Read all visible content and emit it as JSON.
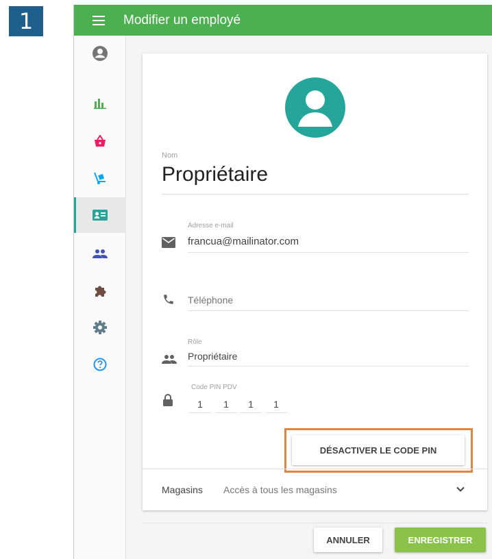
{
  "step_badge": "1",
  "topbar": {
    "title": "Modifier un employé",
    "menu_icon": "hamburger-menu-icon"
  },
  "sidebar": {
    "items": [
      {
        "name": "profile",
        "icon": "account-circle-icon",
        "color": "#757575"
      },
      {
        "name": "reports",
        "icon": "bar-chart-icon",
        "color": "#4caf50"
      },
      {
        "name": "items",
        "icon": "basket-icon",
        "color": "#e91e63"
      },
      {
        "name": "inventory",
        "icon": "cart-dolly-icon",
        "color": "#03a9f4"
      },
      {
        "name": "employees",
        "icon": "id-badge-icon",
        "color": "#26a69a",
        "active": true
      },
      {
        "name": "customers",
        "icon": "people-icon",
        "color": "#3f51b5"
      },
      {
        "name": "integrations",
        "icon": "puzzle-icon",
        "color": "#6d4c41"
      },
      {
        "name": "settings",
        "icon": "gear-icon",
        "color": "#607d8b"
      },
      {
        "name": "help",
        "icon": "help-circle-icon",
        "color": "#2196f3"
      }
    ]
  },
  "form": {
    "name_label": "Nom",
    "name_value": "Propriétaire",
    "email_label": "Adresse e-mail",
    "email_value": "francua@mailinator.com",
    "phone_placeholder": "Téléphone",
    "role_label": "Rôle",
    "role_value": "Propriétaire",
    "pin_label": "Code PIN PDV",
    "pin_digits": [
      "1",
      "1",
      "1",
      "1"
    ],
    "deactivate_pin_label": "DÉSACTIVER LE CODE PIN",
    "stores_label": "Magasins",
    "stores_value": "Accès à tous les magasins"
  },
  "actions": {
    "cancel_label": "ANNULER",
    "save_label": "ENREGISTRER"
  },
  "colors": {
    "topbar": "#4caf50",
    "accent": "#26a69a",
    "save": "#8bc34a",
    "highlight": "#e8843a",
    "badge": "#1f5f8b"
  }
}
